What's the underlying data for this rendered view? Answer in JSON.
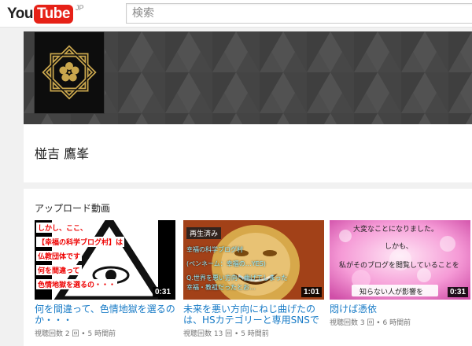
{
  "header": {
    "logo_you": "You",
    "logo_tube": "Tube",
    "logo_region": "JP",
    "search_placeholder": "検索"
  },
  "channel": {
    "name": "椪吉 鷹峯"
  },
  "uploads": {
    "section_title": "アップロード動画",
    "videos": [
      {
        "title": "何を間違って、色情地獄を選るのか・・・",
        "meta": "視聴回数 2 回 • 5 時間前",
        "duration": "0:31",
        "thumb_lines": [
          "しかし、ここ、",
          "【幸福の科学ブログ村】は",
          "仏教団体です",
          "何を間違って",
          "色情地獄を選るの・・・"
        ]
      },
      {
        "title": "未来を悪い方向にねじ曲げたのは、HSカテゴリーと専用SNSで暗躍す…",
        "meta": "視聴回数 13 回 • 5 時間前",
        "duration": "1:01",
        "watched": "再生済み",
        "thumb_lines": [
          "幸福の科学ブログ村",
          "(ペンネーム：幸福の…YES)",
          "Q.世界を悪い方向へ曲げてしまった",
          "幸福・教祖だったとお…"
        ]
      },
      {
        "title": "悶けば憑依",
        "meta": "視聴回数 3 回 • 6 時間前",
        "duration": "0:31",
        "thumb_lines": [
          "大変なことになりました。",
          "しかも、",
          "私がそのブログを閲覧していることを",
          "知らない人が影響を"
        ]
      }
    ]
  },
  "colors": {
    "brand_red": "#e62117",
    "link_blue": "#167ac6",
    "banner_gray": "#4a4a4a"
  }
}
